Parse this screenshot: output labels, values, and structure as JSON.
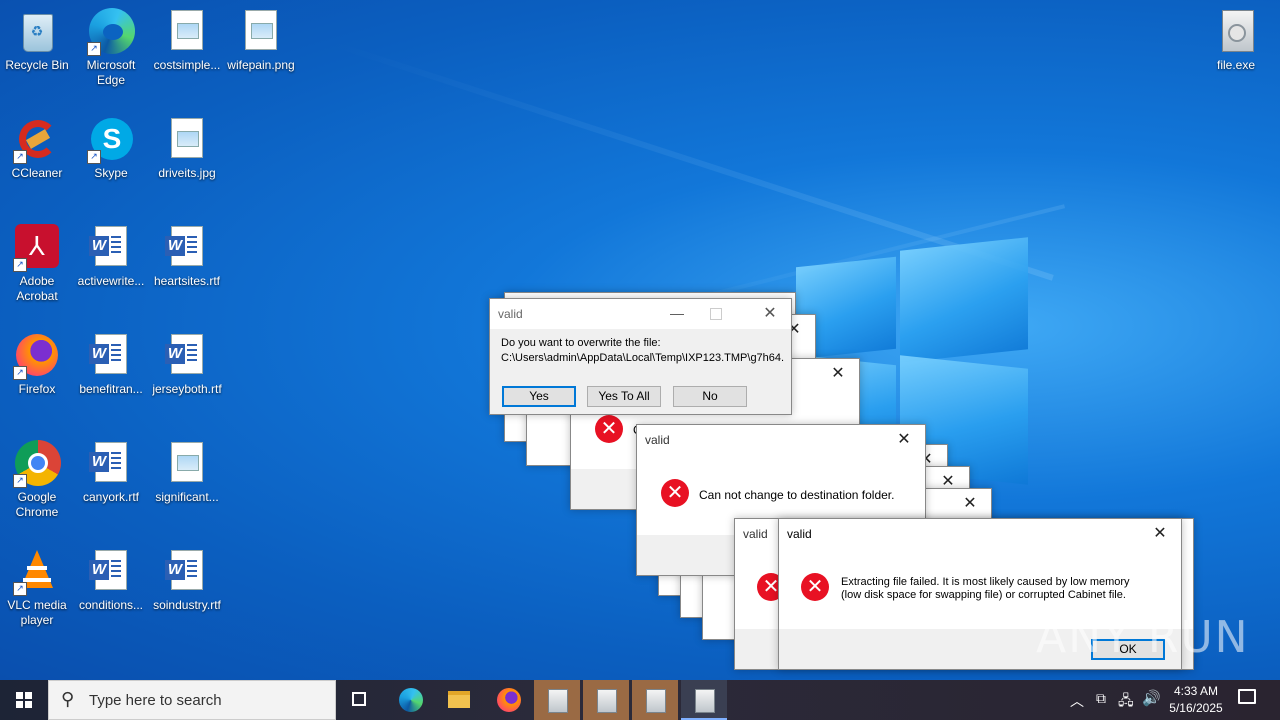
{
  "desktop": {
    "icons": [
      {
        "label": "Recycle Bin"
      },
      {
        "label": "Microsoft Edge"
      },
      {
        "label": "costsimple..."
      },
      {
        "label": "wifepain.png"
      },
      {
        "label": "CCleaner"
      },
      {
        "label": "Skype"
      },
      {
        "label": "driveits.jpg"
      },
      {
        "label": "Adobe Acrobat"
      },
      {
        "label": "activewrite..."
      },
      {
        "label": "heartsites.rtf"
      },
      {
        "label": "Firefox"
      },
      {
        "label": "benefitran..."
      },
      {
        "label": "jerseyboth.rtf"
      },
      {
        "label": "Google Chrome"
      },
      {
        "label": "canyork.rtf"
      },
      {
        "label": "significant..."
      },
      {
        "label": "VLC media player"
      },
      {
        "label": "conditions..."
      },
      {
        "label": "soindustry.rtf"
      },
      {
        "label": "file.exe"
      }
    ]
  },
  "dialogs": {
    "overwrite": {
      "title": "valid",
      "line1": "Do you want to overwrite the file:",
      "line2": "C:\\Users\\admin\\AppData\\Local\\Temp\\IXP123.TMP\\g7h64.",
      "yes": "Yes",
      "yes_all": "Yes To All",
      "no": "No"
    },
    "dest": {
      "title": "valid",
      "message": "Can not change to destination folder."
    },
    "behind_title": "valid",
    "behind_letter": "C",
    "extract": {
      "title": "valid",
      "message1": "Extracting file failed.  It is most likely caused by low memory",
      "message2": "(low disk space for swapping file) or corrupted Cabinet file.",
      "ok": "OK"
    }
  },
  "taskbar": {
    "search_placeholder": "Type here to search",
    "time": "4:33 AM",
    "date": "5/16/2025"
  },
  "watermark": "ANY RUN"
}
